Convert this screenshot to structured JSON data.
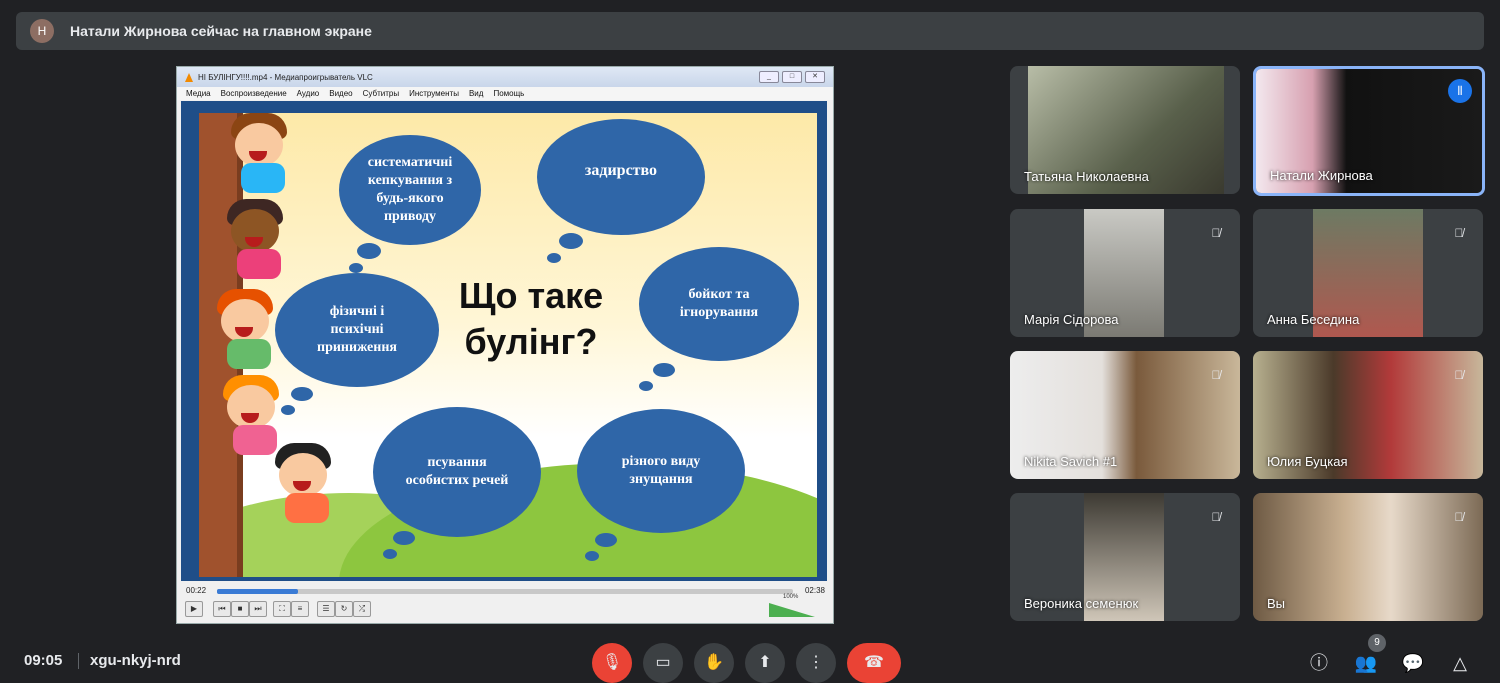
{
  "banner": {
    "avatar_letter": "Н",
    "text": "Натали Жирнова сейчас на главном экране"
  },
  "vlc": {
    "title": "НІ БУЛІНГУ!!!!.mp4 - Медиапроигрыватель VLC",
    "menu": [
      "Медиа",
      "Воспроизведение",
      "Аудио",
      "Видео",
      "Субтитры",
      "Инструменты",
      "Вид",
      "Помощь"
    ],
    "time_elapsed": "00:22",
    "time_total": "02:38",
    "progress": 0.14,
    "volume": "100%"
  },
  "slide": {
    "title_line1": "Що таке",
    "title_line2": "булінг?",
    "clouds": [
      "систематичні кепкування з будь-якого приводу",
      "задирство",
      "бойкот та ігнорування",
      "фізичні і психічні приниження",
      "псування особистих речей",
      "різного виду знущання"
    ]
  },
  "participants": [
    {
      "name": "Татьяна Николаевна",
      "muted": false,
      "speaking": false
    },
    {
      "name": "Натали Жирнова",
      "muted": false,
      "speaking": true
    },
    {
      "name": "Марія Сідорова",
      "muted": true,
      "speaking": false
    },
    {
      "name": "Анна Беседина",
      "muted": true,
      "speaking": false
    },
    {
      "name": "Nikita Savich #1",
      "muted": true,
      "speaking": false
    },
    {
      "name": "Юлия Буцкая",
      "muted": true,
      "speaking": false
    },
    {
      "name": "Вероника семенюк",
      "muted": true,
      "speaking": false
    },
    {
      "name": "Вы",
      "muted": true,
      "speaking": false
    }
  ],
  "bottom": {
    "time": "09:05",
    "meeting_code": "xgu-nkyj-nrd",
    "people_count": "9",
    "icons": {
      "mic": "mic-off-icon",
      "camera": "camera-icon",
      "hand": "raise-hand-icon",
      "present": "present-icon",
      "more": "more-icon",
      "end": "end-call-icon",
      "info": "info-icon",
      "people": "people-icon",
      "chat": "chat-icon",
      "activities": "activities-icon"
    }
  }
}
